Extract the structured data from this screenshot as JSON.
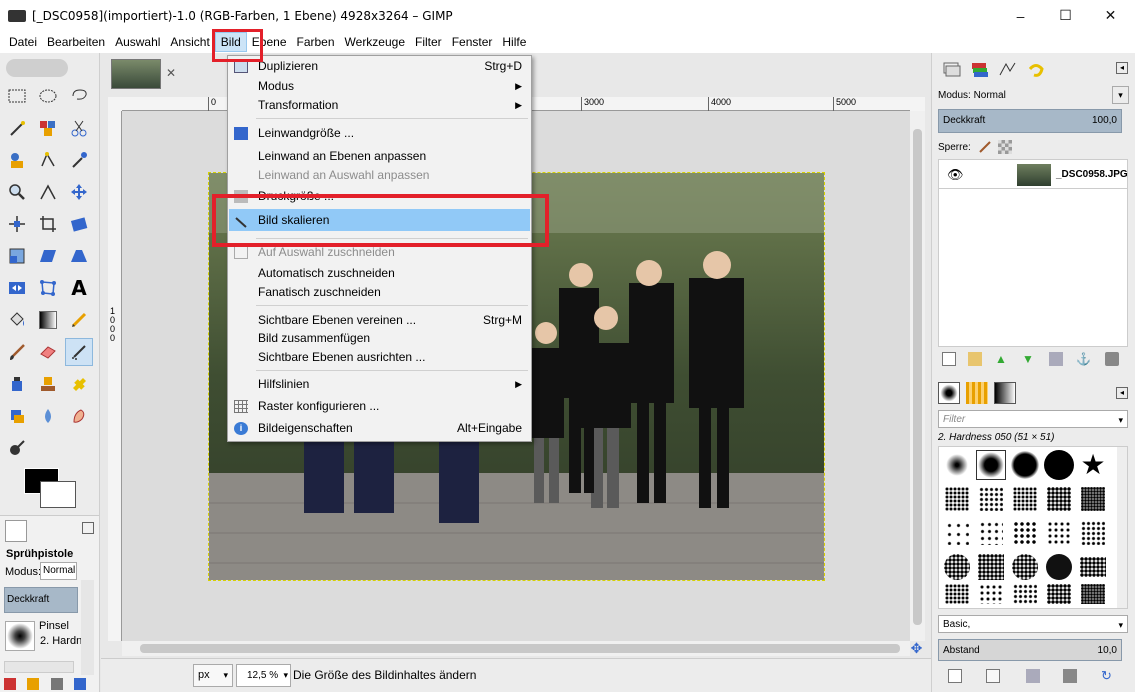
{
  "window": {
    "title": "[_DSC0958](importiert)-1.0 (RGB-Farben, 1 Ebene) 4928x3264 – GIMP",
    "minimize": "–",
    "maximize": "☐",
    "close": "✕"
  },
  "menubar": {
    "items": [
      "Datei",
      "Bearbeiten",
      "Auswahl",
      "Ansicht",
      "Bild",
      "Ebene",
      "Farben",
      "Werkzeuge",
      "Filter",
      "Fenster",
      "Hilfe"
    ],
    "active": "Bild"
  },
  "bild_menu": {
    "items": [
      {
        "label": "Duplizieren",
        "accel": "Strg+D",
        "enabled": true
      },
      {
        "label": "Modus",
        "submenu": true,
        "enabled": true
      },
      {
        "label": "Transformation",
        "submenu": true,
        "enabled": true
      },
      {
        "label": "Leinwandgröße ...",
        "enabled": true
      },
      {
        "label": "Leinwand an Ebenen anpassen",
        "enabled": true
      },
      {
        "label": "Leinwand an Auswahl anpassen",
        "enabled": false
      },
      {
        "label": "Druckgröße ...",
        "enabled": true
      },
      {
        "label": "Bild skalieren",
        "enabled": true,
        "highlighted": true
      },
      {
        "label": "Auf Auswahl zuschneiden",
        "enabled": false
      },
      {
        "label": "Automatisch zuschneiden",
        "enabled": true
      },
      {
        "label": "Fanatisch zuschneiden",
        "enabled": true
      },
      {
        "label": "Sichtbare Ebenen vereinen ...",
        "accel": "Strg+M",
        "enabled": true
      },
      {
        "label": "Bild zusammenfügen",
        "enabled": true
      },
      {
        "label": "Sichtbare Ebenen ausrichten ...",
        "enabled": true
      },
      {
        "label": "Hilfslinien",
        "submenu": true,
        "enabled": true
      },
      {
        "label": "Raster konfigurieren ...",
        "enabled": true
      },
      {
        "label": "Bildeigenschaften",
        "accel": "Alt+Eingabe",
        "enabled": true
      }
    ],
    "submenu_arrow": "▶"
  },
  "ruler": {
    "labels": [
      "0",
      "3000",
      "4000",
      "5000"
    ],
    "vertical_label": "1000"
  },
  "tool_options": {
    "tool_name": "Sprühpistole",
    "mode_label": "Modus:",
    "mode_value": "Normal",
    "opacity_label": "Deckkraft",
    "brush_label": "Pinsel",
    "brush_value": "2. Hardn"
  },
  "statusbar": {
    "unit": "px",
    "zoom": "12,5 %",
    "message": "Die Größe des Bildinhaltes ändern"
  },
  "layers_dock": {
    "mode_label": "Modus: Normal",
    "opacity_label": "Deckkraft",
    "opacity_value": "100,0",
    "lock_label": "Sperre:",
    "layer_name": "_DSC0958.JPG"
  },
  "brushes_dock": {
    "filter_placeholder": "Filter",
    "brush_name": "2. Hardness 050 (51 × 51)",
    "preset": "Basic,",
    "spacing_label": "Abstand",
    "spacing_value": "10,0"
  },
  "colors": {
    "highlight": "#91c9f7",
    "annotation_red": "#e3202a",
    "menu_active": "#cce4f7"
  },
  "icons": [
    "search-icon",
    "eye-icon",
    "brush-icon",
    "close-icon",
    "chevron-down-icon",
    "arrow-right-icon"
  ]
}
